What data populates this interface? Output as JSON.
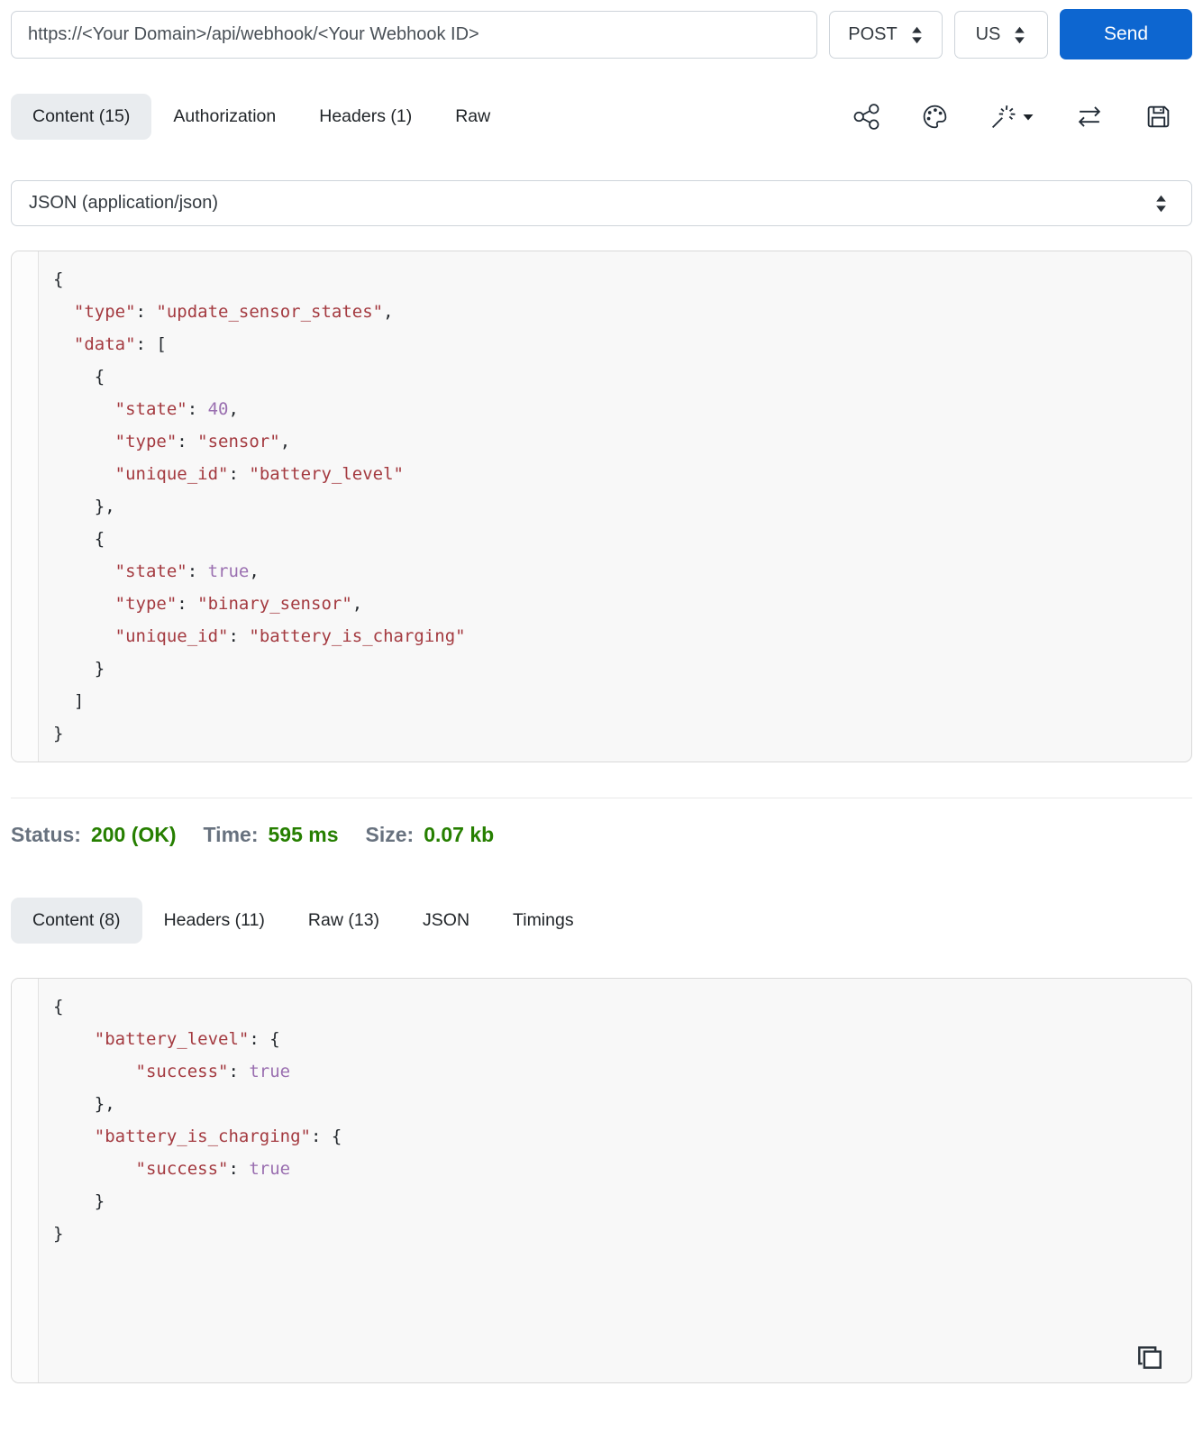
{
  "request_bar": {
    "url_value": "https://<Your Domain>/api/webhook/<Your Webhook ID>",
    "method": "POST",
    "locale": "US",
    "send_label": "Send"
  },
  "request_tabs": {
    "content": "Content (15)",
    "authorization": "Authorization",
    "headers": "Headers (1)",
    "raw": "Raw"
  },
  "toolbar_icons": [
    {
      "name": "share-icon"
    },
    {
      "name": "palette-icon"
    },
    {
      "name": "magic-wand-icon"
    },
    {
      "name": "swap-arrows-icon"
    },
    {
      "name": "save-icon"
    }
  ],
  "body_type_select": {
    "value": "JSON (application/json)"
  },
  "request_body": {
    "lines": [
      "{",
      "  \"type\": \"update_sensor_states\",",
      "  \"data\": [",
      "    {",
      "      \"state\": 40,",
      "      \"type\": \"sensor\",",
      "      \"unique_id\": \"battery_level\"",
      "    },",
      "    {",
      "      \"state\": true,",
      "      \"type\": \"binary_sensor\",",
      "      \"unique_id\": \"battery_is_charging\"",
      "    }",
      "  ]",
      "}"
    ]
  },
  "status_bar": {
    "status_label": "Status:",
    "status_value": "200 (OK)",
    "time_label": "Time:",
    "time_value": "595 ms",
    "size_label": "Size:",
    "size_value": "0.07 kb"
  },
  "response_tabs": {
    "content": "Content (8)",
    "headers": "Headers (11)",
    "raw": "Raw (13)",
    "json": "JSON",
    "timings": "Timings"
  },
  "response_body": {
    "lines": [
      "{",
      "    \"battery_level\": {",
      "        \"success\": true",
      "    },",
      "    \"battery_is_charging\": {",
      "        \"success\": true",
      "    }",
      "}"
    ]
  },
  "colors": {
    "accent_blue": "#0d66d0",
    "status_green": "#267f00",
    "code_string_red": "#a43a40",
    "code_literal_purple": "#9a6fb0",
    "active_tab_bg": "#e9ecef"
  }
}
